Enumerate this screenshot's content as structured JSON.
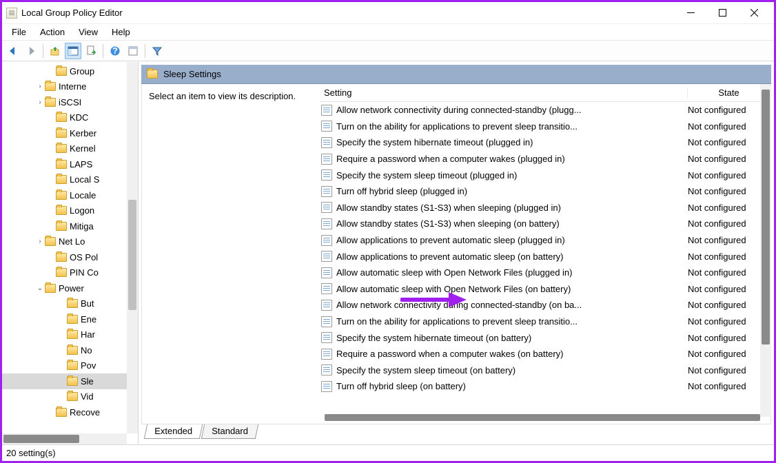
{
  "window": {
    "title": "Local Group Policy Editor"
  },
  "menu": [
    "File",
    "Action",
    "View",
    "Help"
  ],
  "detail": {
    "header": "Sleep Settings",
    "descPrompt": "Select an item to view its description.",
    "colSetting": "Setting",
    "colState": "State",
    "rows": [
      {
        "setting": "Allow network connectivity during connected-standby (plugg...",
        "state": "Not configured"
      },
      {
        "setting": "Turn on the ability for applications to prevent sleep transitio...",
        "state": "Not configured"
      },
      {
        "setting": "Specify the system hibernate timeout (plugged in)",
        "state": "Not configured"
      },
      {
        "setting": "Require a password when a computer wakes (plugged in)",
        "state": "Not configured"
      },
      {
        "setting": "Specify the system sleep timeout (plugged in)",
        "state": "Not configured"
      },
      {
        "setting": "Turn off hybrid sleep (plugged in)",
        "state": "Not configured"
      },
      {
        "setting": "Allow standby states (S1-S3) when sleeping (plugged in)",
        "state": "Not configured"
      },
      {
        "setting": "Allow standby states (S1-S3) when sleeping (on battery)",
        "state": "Not configured"
      },
      {
        "setting": "Allow applications to prevent automatic sleep (plugged in)",
        "state": "Not configured"
      },
      {
        "setting": "Allow applications to prevent automatic sleep (on battery)",
        "state": "Not configured"
      },
      {
        "setting": "Allow automatic sleep with Open Network Files (plugged in)",
        "state": "Not configured"
      },
      {
        "setting": "Allow automatic sleep with Open Network Files (on battery)",
        "state": "Not configured"
      },
      {
        "setting": "Allow network connectivity during connected-standby (on ba...",
        "state": "Not configured"
      },
      {
        "setting": "Turn on the ability for applications to prevent sleep transitio...",
        "state": "Not configured"
      },
      {
        "setting": "Specify the system hibernate timeout (on battery)",
        "state": "Not configured"
      },
      {
        "setting": "Require a password when a computer wakes (on battery)",
        "state": "Not configured"
      },
      {
        "setting": "Specify the system sleep timeout (on battery)",
        "state": "Not configured"
      },
      {
        "setting": "Turn off hybrid sleep (on battery)",
        "state": "Not configured"
      }
    ]
  },
  "tree": [
    {
      "label": "Group",
      "indent": 4,
      "twisty": ""
    },
    {
      "label": "Interne",
      "indent": 3,
      "twisty": ">"
    },
    {
      "label": "iSCSI",
      "indent": 3,
      "twisty": ">"
    },
    {
      "label": "KDC",
      "indent": 4,
      "twisty": ""
    },
    {
      "label": "Kerber",
      "indent": 4,
      "twisty": ""
    },
    {
      "label": "Kernel",
      "indent": 4,
      "twisty": ""
    },
    {
      "label": "LAPS",
      "indent": 4,
      "twisty": ""
    },
    {
      "label": "Local S",
      "indent": 4,
      "twisty": ""
    },
    {
      "label": "Locale",
      "indent": 4,
      "twisty": ""
    },
    {
      "label": "Logon",
      "indent": 4,
      "twisty": ""
    },
    {
      "label": "Mitiga",
      "indent": 4,
      "twisty": ""
    },
    {
      "label": "Net Lo",
      "indent": 3,
      "twisty": ">"
    },
    {
      "label": "OS Pol",
      "indent": 4,
      "twisty": ""
    },
    {
      "label": "PIN Co",
      "indent": 4,
      "twisty": ""
    },
    {
      "label": "Power",
      "indent": 3,
      "twisty": "v"
    },
    {
      "label": "But",
      "indent": 5,
      "twisty": ""
    },
    {
      "label": "Ene",
      "indent": 5,
      "twisty": ""
    },
    {
      "label": "Har",
      "indent": 5,
      "twisty": ""
    },
    {
      "label": "No",
      "indent": 5,
      "twisty": ""
    },
    {
      "label": "Pov",
      "indent": 5,
      "twisty": ""
    },
    {
      "label": "Sle",
      "indent": 5,
      "twisty": "",
      "selected": true
    },
    {
      "label": "Vid",
      "indent": 5,
      "twisty": ""
    },
    {
      "label": "Recove",
      "indent": 4,
      "twisty": ""
    }
  ],
  "tabs": {
    "extended": "Extended",
    "standard": "Standard"
  },
  "status": "20 setting(s)"
}
